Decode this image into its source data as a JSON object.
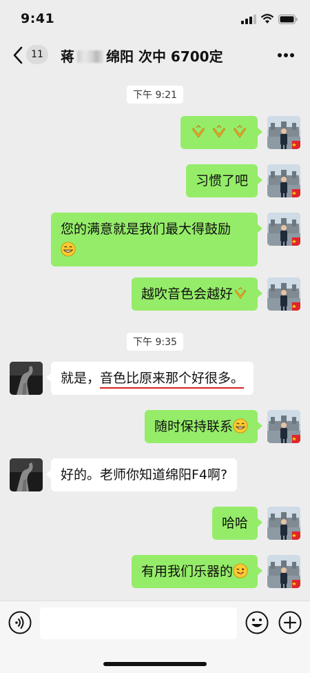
{
  "status_bar": {
    "time": "9:41"
  },
  "nav": {
    "unread_count": "11",
    "title_prefix": "蒋",
    "title_suffix": "绵阳 次中 6700定"
  },
  "timestamps": [
    "下午 9:21",
    "下午 9:35"
  ],
  "messages": [
    {
      "from": "me",
      "text": "",
      "emoji": "folded-hands-x3"
    },
    {
      "from": "me",
      "text": "习惯了吧"
    },
    {
      "from": "me",
      "text": "您的满意就是我们最大得鼓励",
      "emoji": "grinning-face"
    },
    {
      "from": "me",
      "text": "越吹音色会越好",
      "emoji": "folded-hands"
    },
    {
      "from": "other",
      "text_a": "就是，",
      "text_b": "音色比原来那个好很多。"
    },
    {
      "from": "me",
      "text": "随时保持联系",
      "emoji": "grinning-face"
    },
    {
      "from": "other",
      "text": "好的。老师你知道绵阳F4啊?"
    },
    {
      "from": "me",
      "text": "哈哈"
    },
    {
      "from": "me",
      "text": "有用我们乐器的",
      "emoji": "winking-tongue-face"
    }
  ],
  "input": {
    "value": "",
    "placeholder": ""
  },
  "colors": {
    "me_bubble": "#95ec69",
    "other_bubble": "#ffffff",
    "background": "#ededed",
    "underline": "#d62020"
  }
}
